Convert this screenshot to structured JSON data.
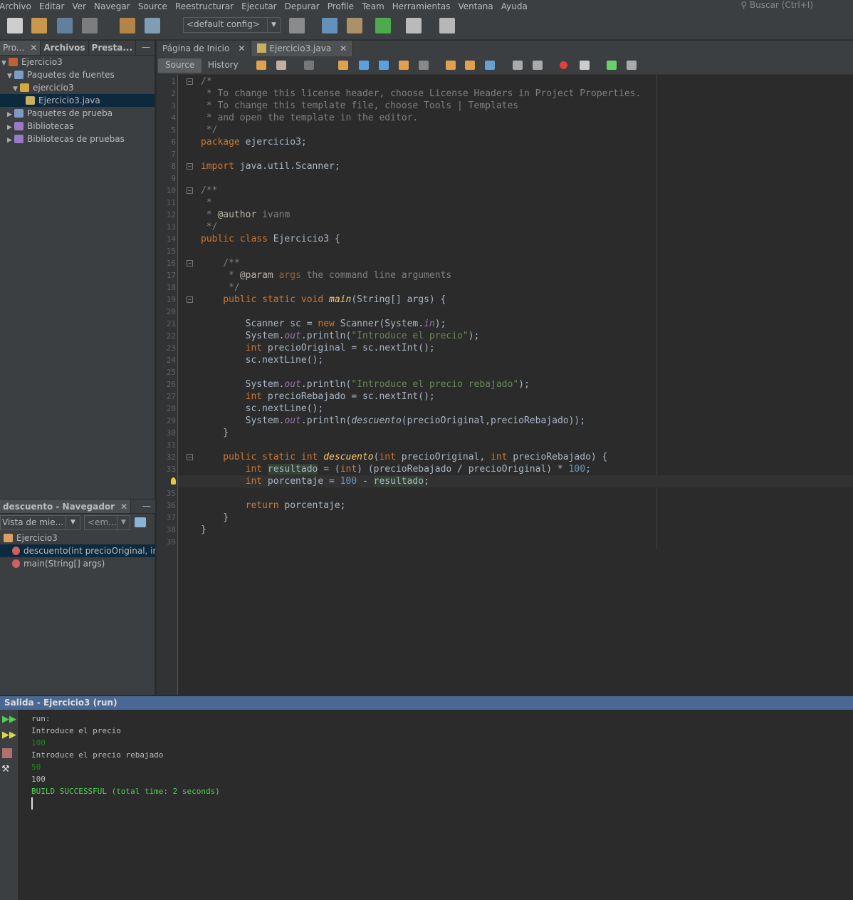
{
  "menu": [
    "Archivo",
    "Editar",
    "Ver",
    "Navegar",
    "Source",
    "Reestructurar",
    "Ejecutar",
    "Depurar",
    "Profile",
    "Team",
    "Herramientas",
    "Ventana",
    "Ayuda"
  ],
  "search_placeholder": "Buscar (Ctrl+I)",
  "toolbar": {
    "config": "<default config>",
    "icons": [
      "new-file-icon",
      "new-project-icon",
      "open-project-icon",
      "save-all-icon",
      "undo-icon",
      "redo-icon",
      "globe-icon",
      "build-hammer-icon",
      "clean-build-icon",
      "run-icon",
      "debug-icon",
      "profile-icon"
    ]
  },
  "left_tabs": [
    {
      "label": "Pro...",
      "close": "✕"
    },
    {
      "label": "Archivos"
    },
    {
      "label": "Presta..."
    }
  ],
  "tree": [
    {
      "label": "Ejercicio3",
      "depth": 0,
      "twisty": "▼",
      "icon": "coffee-project-icon",
      "color": "#c0603a"
    },
    {
      "label": "Paquetes de fuentes",
      "depth": 1,
      "twisty": "▼",
      "icon": "source-packages-icon",
      "color": "#7a9cc6"
    },
    {
      "label": "ejercicio3",
      "depth": 2,
      "twisty": "▼",
      "icon": "package-icon",
      "color": "#d9a740"
    },
    {
      "label": "Ejercicio3.java",
      "depth": 3,
      "twisty": "",
      "icon": "java-file-icon",
      "color": "#c8b060",
      "selected": true
    },
    {
      "label": "Paquetes de prueba",
      "depth": 1,
      "twisty": "▶",
      "icon": "test-packages-icon",
      "color": "#7a9cc6"
    },
    {
      "label": "Bibliotecas",
      "depth": 1,
      "twisty": "▶",
      "icon": "libraries-icon",
      "color": "#9a7ac6"
    },
    {
      "label": "Bibliotecas de pruebas",
      "depth": 1,
      "twisty": "▶",
      "icon": "test-libraries-icon",
      "color": "#9a7ac6"
    }
  ],
  "navigator": {
    "title": "descuento - Navegador",
    "combo1": "Vista de mie...",
    "combo2": "<em...",
    "class": "Ejercicio3",
    "members": [
      {
        "label": "descuento(int precioOriginal, int precioRebajado)",
        "selected": true
      },
      {
        "label": "main(String[] args)"
      }
    ]
  },
  "editor_tabs": [
    {
      "label": "Página de Inicio"
    },
    {
      "label": "Ejercicio3.java",
      "active": true
    }
  ],
  "close_glyph": "✕",
  "minimize_glyph": "—",
  "source_tabs": {
    "source": "Source",
    "history": "History"
  },
  "current_line": 34,
  "code": [
    [
      [
        "c",
        "/*"
      ]
    ],
    [
      [
        "c",
        " * To change this license header, choose License Headers in Project Properties."
      ]
    ],
    [
      [
        "c",
        " * To change this template file, choose Tools | Templates"
      ]
    ],
    [
      [
        "c",
        " * and open the template in the editor."
      ]
    ],
    [
      [
        "c",
        " */"
      ]
    ],
    [
      [
        "k",
        "package "
      ],
      [
        "t",
        "ejercicio3;"
      ]
    ],
    [],
    [
      [
        "k",
        "import "
      ],
      [
        "t",
        "java.util.Scanner;"
      ]
    ],
    [],
    [
      [
        "c",
        "/**"
      ]
    ],
    [
      [
        "c",
        " *"
      ]
    ],
    [
      [
        "c",
        " * "
      ],
      [
        "a",
        "@author"
      ],
      [
        "c",
        " ivanm"
      ]
    ],
    [
      [
        "c",
        " */"
      ]
    ],
    [
      [
        "k",
        "public class "
      ],
      [
        "t",
        "Ejercicio3 {"
      ]
    ],
    [],
    [
      [
        "c",
        "    /**"
      ]
    ],
    [
      [
        "c",
        "     * "
      ],
      [
        "a",
        "@param"
      ],
      [
        "p",
        " args"
      ],
      [
        "c",
        " the command line arguments"
      ]
    ],
    [
      [
        "c",
        "     */"
      ]
    ],
    [
      [
        "k",
        "    public static void "
      ],
      [
        "f",
        "main"
      ],
      [
        "t",
        "(String[] args) {"
      ]
    ],
    [],
    [
      [
        "t",
        "        Scanner sc = "
      ],
      [
        "k",
        "new "
      ],
      [
        "t",
        "Scanner(System."
      ],
      [
        "st",
        "in"
      ],
      [
        "t",
        ");"
      ]
    ],
    [
      [
        "t",
        "        System."
      ],
      [
        "st",
        "out"
      ],
      [
        "t",
        ".println("
      ],
      [
        "s",
        "\"Introduce el precio\""
      ],
      [
        "t",
        ");"
      ]
    ],
    [
      [
        "k",
        "        int "
      ],
      [
        "t",
        "precioOriginal = sc.nextInt();"
      ]
    ],
    [
      [
        "t",
        "        sc.nextLine();"
      ]
    ],
    [],
    [
      [
        "t",
        "        System."
      ],
      [
        "st",
        "out"
      ],
      [
        "t",
        ".println("
      ],
      [
        "s",
        "\"Introduce el precio rebajado\""
      ],
      [
        "t",
        ");"
      ]
    ],
    [
      [
        "k",
        "        int "
      ],
      [
        "t",
        "precioRebajado = sc.nextInt();"
      ]
    ],
    [
      [
        "t",
        "        sc.nextLine();"
      ]
    ],
    [
      [
        "t",
        "        System."
      ],
      [
        "st",
        "out"
      ],
      [
        "t",
        ".println("
      ],
      [
        "fi",
        "descuento"
      ],
      [
        "t",
        "(precioOriginal,precioRebajado));"
      ]
    ],
    [
      [
        "t",
        "    }"
      ]
    ],
    [],
    [
      [
        "k",
        "    public static int "
      ],
      [
        "f",
        "descuento"
      ],
      [
        "t",
        "("
      ],
      [
        "k",
        "int "
      ],
      [
        "t",
        "precioOriginal, "
      ],
      [
        "k",
        "int "
      ],
      [
        "t",
        "precioRebajado) {"
      ]
    ],
    [
      [
        "k",
        "        int "
      ],
      [
        "hl",
        "resultado"
      ],
      [
        "t",
        " = ("
      ],
      [
        "k",
        "int"
      ],
      [
        "t",
        ") (precioRebajado / precioOriginal) * "
      ],
      [
        "n",
        "100"
      ],
      [
        "t",
        ";"
      ]
    ],
    [
      [
        "k",
        "        int "
      ],
      [
        "t",
        "porcentaje = "
      ],
      [
        "n",
        "100"
      ],
      [
        "t",
        " - "
      ],
      [
        "hl",
        "resultado"
      ],
      [
        "t",
        ";"
      ]
    ],
    [],
    [
      [
        "k",
        "        return "
      ],
      [
        "t",
        "porcentaje;"
      ]
    ],
    [
      [
        "t",
        "    }"
      ]
    ],
    [
      [
        "t",
        "}"
      ]
    ],
    []
  ],
  "folds": [
    1,
    8,
    10,
    16,
    19,
    32
  ],
  "output": {
    "title": "Salida - Ejercicio3 (run)",
    "lines": [
      {
        "text": "run:",
        "color": "#bbbbbb"
      },
      {
        "text": "Introduce el precio",
        "color": "#bbbbbb"
      },
      {
        "text": "100",
        "color": "#1e8a1e"
      },
      {
        "text": "Introduce el precio rebajado",
        "color": "#bbbbbb"
      },
      {
        "text": "50",
        "color": "#1e8a1e"
      },
      {
        "text": "100",
        "color": "#bbbbbb"
      },
      {
        "text": "BUILD SUCCESSFUL (total time: 2 seconds)",
        "color": "#4fd24f"
      }
    ]
  }
}
